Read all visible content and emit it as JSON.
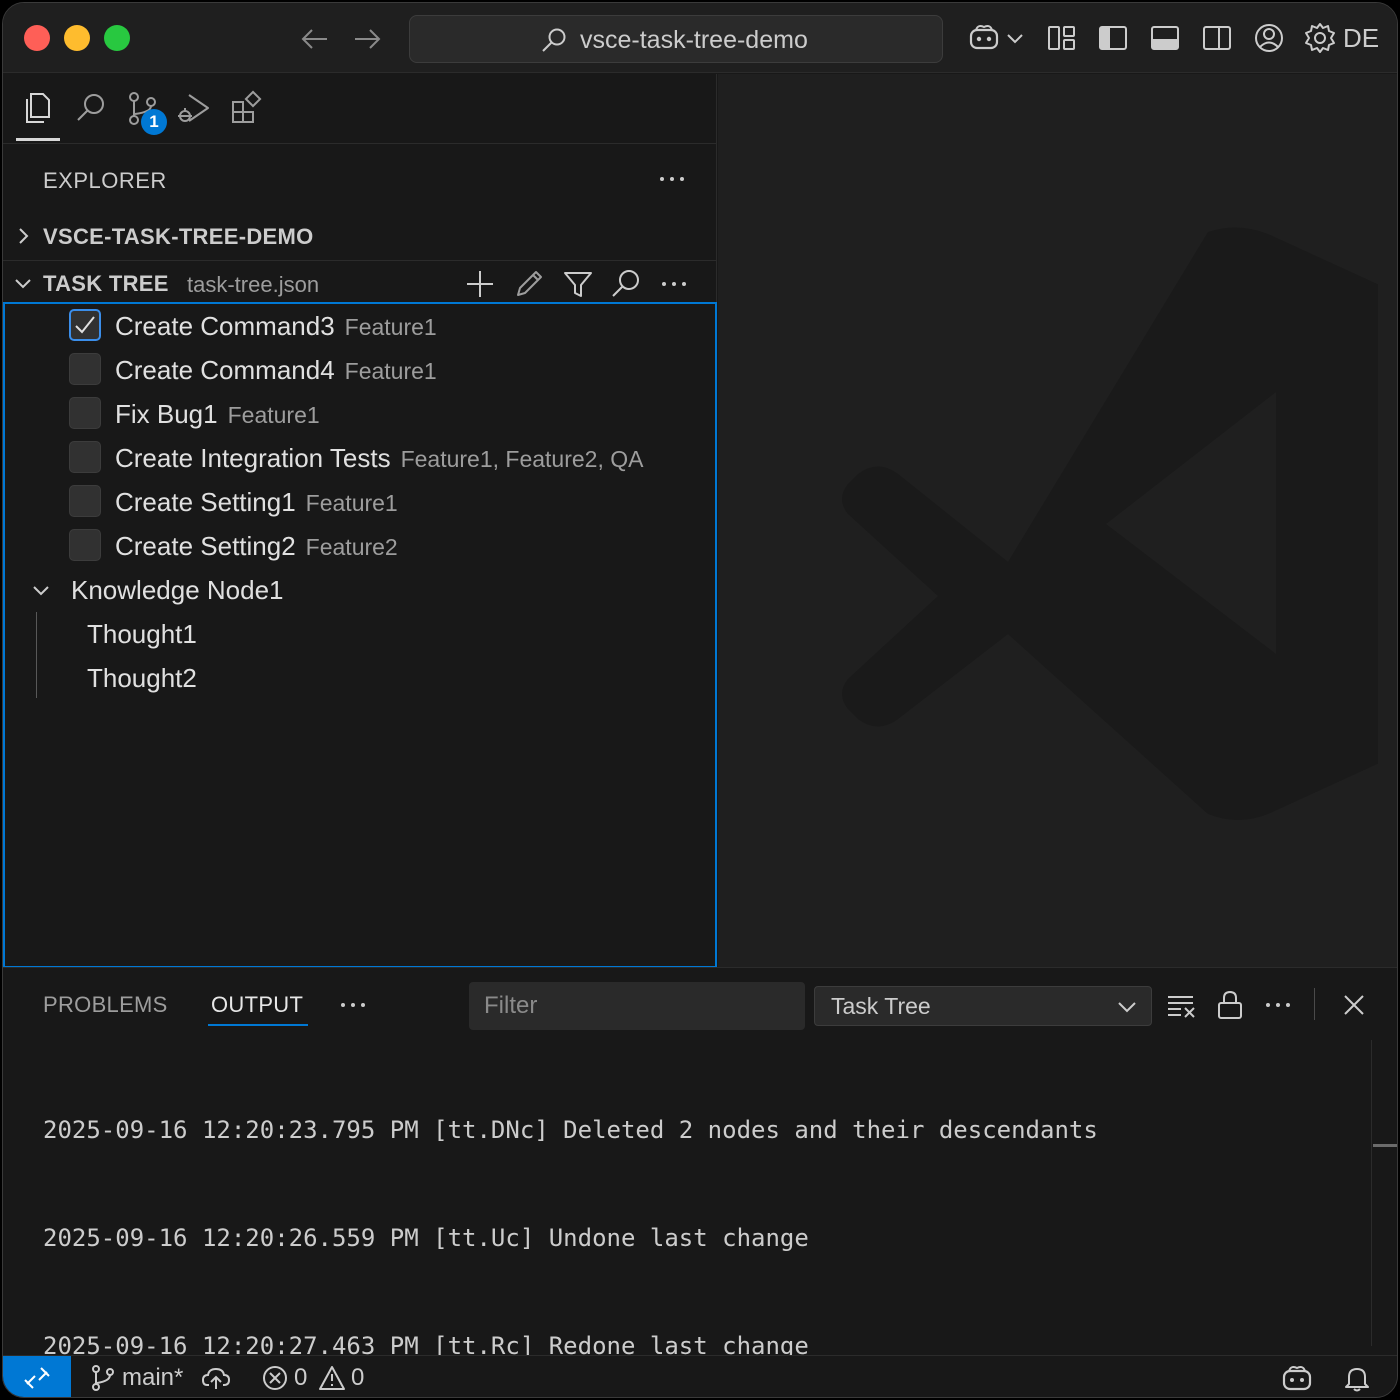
{
  "titlebar": {
    "command_center": "vsce-task-tree-demo",
    "account_label": "DE"
  },
  "sidebar": {
    "badge_count": "1",
    "explorer_title": "EXPLORER",
    "workspace_section": "VSCE-TASK-TREE-DEMO",
    "task_tree_section": {
      "title": "TASK TREE",
      "description": "task-tree.json"
    },
    "tree": [
      {
        "label": "Create Command3",
        "desc": "Feature1",
        "checked": true
      },
      {
        "label": "Create Command4",
        "desc": "Feature1",
        "checked": false
      },
      {
        "label": "Fix Bug1",
        "desc": "Feature1",
        "checked": false
      },
      {
        "label": "Create Integration Tests",
        "desc": "Feature1, Feature2, QA",
        "checked": false
      },
      {
        "label": "Create Setting1",
        "desc": "Feature1",
        "checked": false
      },
      {
        "label": "Create Setting2",
        "desc": "Feature2",
        "checked": false
      }
    ],
    "knowledge_node": {
      "label": "Knowledge Node1",
      "children": [
        "Thought1",
        "Thought2"
      ]
    }
  },
  "panel": {
    "tabs": [
      "PROBLEMS",
      "OUTPUT"
    ],
    "active_tab": "OUTPUT",
    "filter_placeholder": "Filter",
    "channel": "Task Tree",
    "log_lines": [
      "2025-09-16 12:20:23.795 PM [tt.DNc] Deleted 2 nodes and their descendants",
      "2025-09-16 12:20:26.559 PM [tt.Uc] Undone last change",
      "2025-09-16 12:20:27.463 PM [tt.Rc] Redone last change"
    ]
  },
  "statusbar": {
    "branch": "main*",
    "errors": "0",
    "warnings": "0"
  },
  "colors": {
    "accent": "#0078d4",
    "background": "#181818",
    "editor_background": "#1f1f1f"
  }
}
